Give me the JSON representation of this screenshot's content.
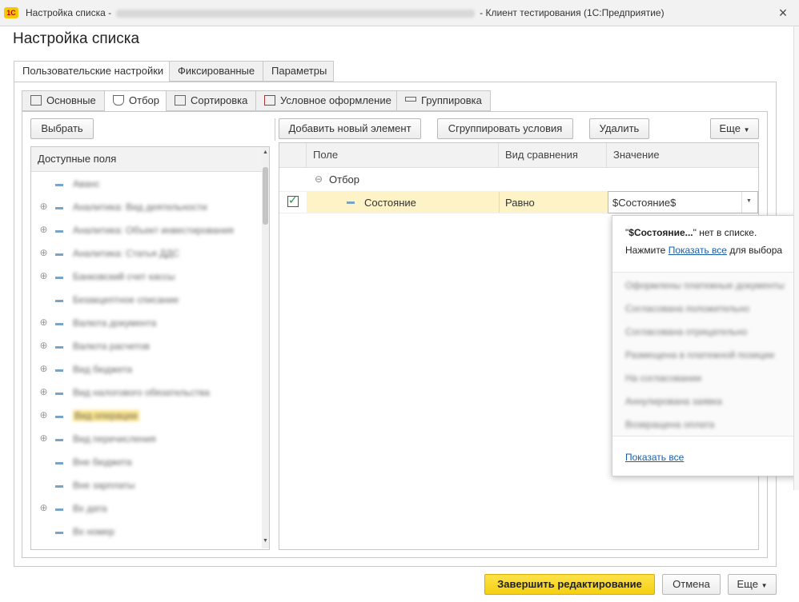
{
  "window": {
    "logo": "1С",
    "title_prefix": "Настройка списка -",
    "title_suffix": "- Клиент тестирования (1С:Предприятие)",
    "close": "×"
  },
  "page_title": "Настройка списка",
  "top_tabs": [
    "Пользовательские настройки",
    "Фиксированные",
    "Параметры"
  ],
  "sub_tabs": [
    "Основные",
    "Отбор",
    "Сортировка",
    "Условное оформление",
    "Группировка"
  ],
  "left": {
    "select_button": "Выбрать",
    "fields_header": "Доступные поля",
    "fields": [
      {
        "label": "Аванс",
        "expandable": false
      },
      {
        "label": "Аналитика: Вид деятельности",
        "expandable": true
      },
      {
        "label": "Аналитика: Объект инвестирования",
        "expandable": true
      },
      {
        "label": "Аналитика: Статья ДДС",
        "expandable": true
      },
      {
        "label": "Банковский счет кассы",
        "expandable": true
      },
      {
        "label": "Безакцептное списание",
        "expandable": false
      },
      {
        "label": "Валюта документа",
        "expandable": true
      },
      {
        "label": "Валюта расчетов",
        "expandable": true
      },
      {
        "label": "Вид бюджета",
        "expandable": true
      },
      {
        "label": "Вид налогового обязательства",
        "expandable": true
      },
      {
        "label": "Вид операции",
        "expandable": true
      },
      {
        "label": "Вид перечисления",
        "expandable": true
      },
      {
        "label": "Вне бюджета",
        "expandable": false
      },
      {
        "label": "Вне зарплаты",
        "expandable": false
      },
      {
        "label": "Вх дата",
        "expandable": true
      },
      {
        "label": "Вх номер",
        "expandable": false
      }
    ]
  },
  "right": {
    "toolbar": {
      "add": "Добавить новый элемент",
      "group": "Сгруппировать условия",
      "delete": "Удалить",
      "more": "Еще"
    },
    "columns": [
      "Поле",
      "Вид сравнения",
      "Значение"
    ],
    "group_node": "Отбор",
    "row": {
      "field": "Состояние",
      "comparison": "Равно",
      "value": "$Состояние$",
      "checked": true
    }
  },
  "popup": {
    "msg_quote_open": "\"",
    "msg_bold": "$Состояние...",
    "msg_rest": "\" нет в списке.",
    "hint_prefix": "Нажмите",
    "hint_link": "Показать все",
    "hint_suffix": "для выбора",
    "items": [
      "Оформлены платежные документы",
      "Согласована положительно",
      "Согласована отрицательно",
      "Размещена в платежной позиции",
      "На согласовании",
      "Аннулирована заявка",
      "Возвращена оплата"
    ],
    "show_all": "Показать все"
  },
  "footer": {
    "finish": "Завершить редактирование",
    "cancel": "Отмена",
    "more": "Еще"
  }
}
